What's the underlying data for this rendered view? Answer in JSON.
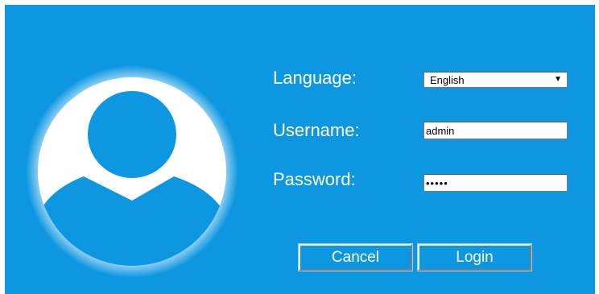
{
  "form": {
    "language_label": "Language:",
    "username_label": "Username:",
    "password_label": "Password:",
    "language_value": "English",
    "username_value": "admin",
    "password_value": "•••••"
  },
  "buttons": {
    "cancel_label": "Cancel",
    "login_label": "Login"
  },
  "icons": {
    "avatar": "user-avatar-icon",
    "dropdown": "chevron-down-icon"
  },
  "colors": {
    "panel_background": "#0d97e1",
    "text": "#ffffff"
  }
}
